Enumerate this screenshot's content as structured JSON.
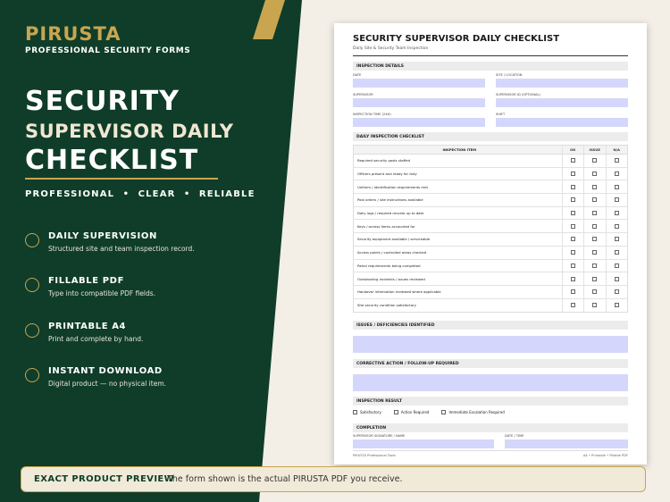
{
  "brand": {
    "name": "PIRUSTA",
    "tagline": "PROFESSIONAL SECURITY FORMS"
  },
  "hero": {
    "line1": "SECURITY",
    "line2": "SUPERVISOR DAILY",
    "line3": "CHECKLIST",
    "tagline": "PROFESSIONAL  •  CLEAR  •  RELIABLE"
  },
  "features": [
    {
      "title": "DAILY SUPERVISION",
      "desc": "Structured site and team inspection record."
    },
    {
      "title": "FILLABLE PDF",
      "desc": "Type into compatible PDF fields."
    },
    {
      "title": "PRINTABLE A4",
      "desc": "Print and complete by hand."
    },
    {
      "title": "INSTANT DOWNLOAD",
      "desc": "Digital product — no physical item."
    }
  ],
  "doc": {
    "title": "SECURITY SUPERVISOR DAILY CHECKLIST",
    "subtitle": "Daily Site & Security Team Inspection",
    "inspection_details": "INSPECTION DETAILS",
    "fields": {
      "date": "DATE",
      "site": "SITE / LOCATION",
      "supervisor": "SUPERVISOR",
      "supervisor_id": "SUPERVISOR ID (OPTIONAL)",
      "time": "INSPECTION TIME (24H)",
      "shift": "SHIFT"
    },
    "checklist_title": "DAILY INSPECTION CHECKLIST",
    "columns": {
      "item": "INSPECTION ITEM",
      "ok": "OK",
      "issue": "ISSUE",
      "na": "N/A"
    },
    "items": [
      "Required security posts staffed",
      "Officers present and ready for duty",
      "Uniform / identification requirements met",
      "Post orders / site instructions available",
      "Daily logs / required records up to date",
      "Keys / access items accounted for",
      "Security equipment available / serviceable",
      "Access points / controlled areas checked",
      "Patrol requirements being completed",
      "Outstanding incidents / issues reviewed",
      "Handover information reviewed where applicable",
      "Site security condition satisfactory"
    ],
    "issues_title": "ISSUES / DEFICIENCIES IDENTIFIED",
    "corrective_title": "CORRECTIVE ACTION / FOLLOW-UP REQUIRED",
    "result_title": "INSPECTION RESULT",
    "results": [
      "Satisfactory",
      "Action Required",
      "Immediate Escalation Required"
    ],
    "completion_title": "COMPLETION",
    "sig_label": "SUPERVISOR SIGNATURE / NAME",
    "datetime_label": "DATE / TIME",
    "footer_left": "PIRUSTA Professional Tools",
    "footer_right": "A4 • Printable • Fillable PDF"
  },
  "banner": {
    "strong": "EXACT PRODUCT PREVIEW",
    "text": "The form shown is the actual PIRUSTA PDF you receive."
  },
  "colors": {
    "green": "#0f3d2a",
    "gold": "#c9a54f",
    "cream": "#f3efe6",
    "field": "#d4d7fb"
  }
}
